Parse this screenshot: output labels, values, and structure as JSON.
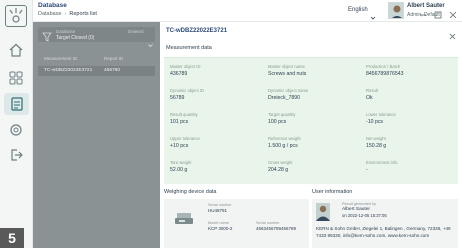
{
  "app": {
    "title": "Database",
    "breadcrumb": [
      "Database",
      "Reports list"
    ]
  },
  "header": {
    "language": "English",
    "user_name": "Albert Sauter",
    "user_role": "Admin, Default"
  },
  "step_badge": "5",
  "list": {
    "filter_label": "Database",
    "filter_value": "Target Closed (0)",
    "filter_aux": "Deleted",
    "columns": [
      "Measurement ID",
      "Report ID"
    ],
    "rows": [
      {
        "id": "TC-wDBZ22022E3721",
        "report": "456780"
      }
    ]
  },
  "detail": {
    "id": "TC-wDBZ22022E3721",
    "measurement_title": "Measurement data",
    "fields": [
      {
        "label": "Master object ID",
        "value": "436789"
      },
      {
        "label": "Master object name",
        "value": "Screws and nuts"
      },
      {
        "label": "Production / Batch",
        "value": "8456789876543"
      },
      {
        "label": "Dynamic object ID",
        "value": "56789"
      },
      {
        "label": "Dynamic object name",
        "value": "Dreieck_7890"
      },
      {
        "label": "Result",
        "value": "Ok"
      },
      {
        "label": "Result quantity",
        "value": "101 pcs"
      },
      {
        "label": "Target quantity",
        "value": "100 pcs"
      },
      {
        "label": "Lower tolerance",
        "value": "-10 pcs"
      },
      {
        "label": "Upper tolerance",
        "value": "+10 pcs"
      },
      {
        "label": "Reference weight",
        "value": "1.500 g / pcs"
      },
      {
        "label": "Net weight",
        "value": "150.28 g"
      },
      {
        "label": "Tare weight",
        "value": "52.00 g"
      },
      {
        "label": "Gross weight",
        "value": "204.28 g"
      },
      {
        "label": "Environment info",
        "value": "-"
      }
    ],
    "weighing_title": "Weighing device data",
    "weighing": {
      "serial_label": "Serial number",
      "serial_value": "HU48791",
      "model_label": "Model name",
      "model_value": "KCP 3000-2",
      "serial2_label": "Serial number",
      "serial2_value": "4563456789456789"
    },
    "user_title": "User information",
    "user": {
      "by_label": "Result generated by",
      "name": "Albert Sauter",
      "date": "on 2022-12-05 15:37:05",
      "address": "KERN & Sohn GmbH, Ziegelei 1, Balingen , Germany, 72336, +49 7433 99330, info@kern-sohn.com, www.kern-sohn.com"
    }
  },
  "colors": {
    "accent": "#2c4b7a",
    "measurement_bg": "#e9f5eb",
    "list_overlay": "#8b9293",
    "badge": "#595959"
  },
  "icons": [
    "logo-icon",
    "home-icon",
    "apps-icon",
    "reports-icon",
    "settings-icon",
    "logout-icon",
    "filter-icon",
    "chevron-down-icon",
    "minimize-icon",
    "maximize-icon",
    "close-icon",
    "scale-device-icon"
  ]
}
